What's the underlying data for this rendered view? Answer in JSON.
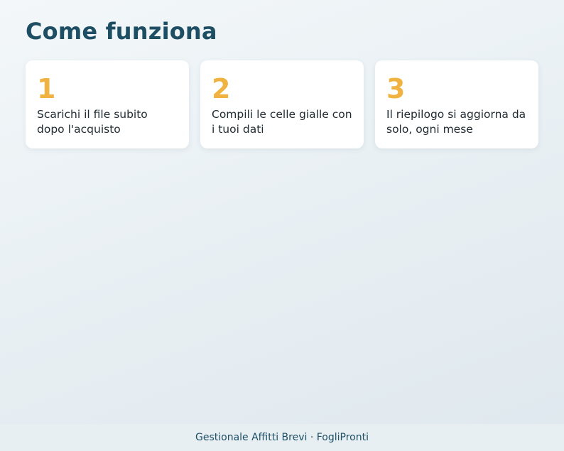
{
  "page": {
    "title": "Come funziona"
  },
  "steps": [
    {
      "number": "1",
      "text": "Scarichi il file subito dopo l'acquisto"
    },
    {
      "number": "2",
      "text": "Compili le celle gialle con i tuoi dati"
    },
    {
      "number": "3",
      "text": "Il riepilogo si aggiorna da solo, ogni mese"
    }
  ],
  "footer": {
    "text": "Gestionale Affitti Brevi · FogliPronti"
  },
  "colors": {
    "title": "#1d4e63",
    "accent": "#f0b342",
    "card_background": "#ffffff"
  }
}
